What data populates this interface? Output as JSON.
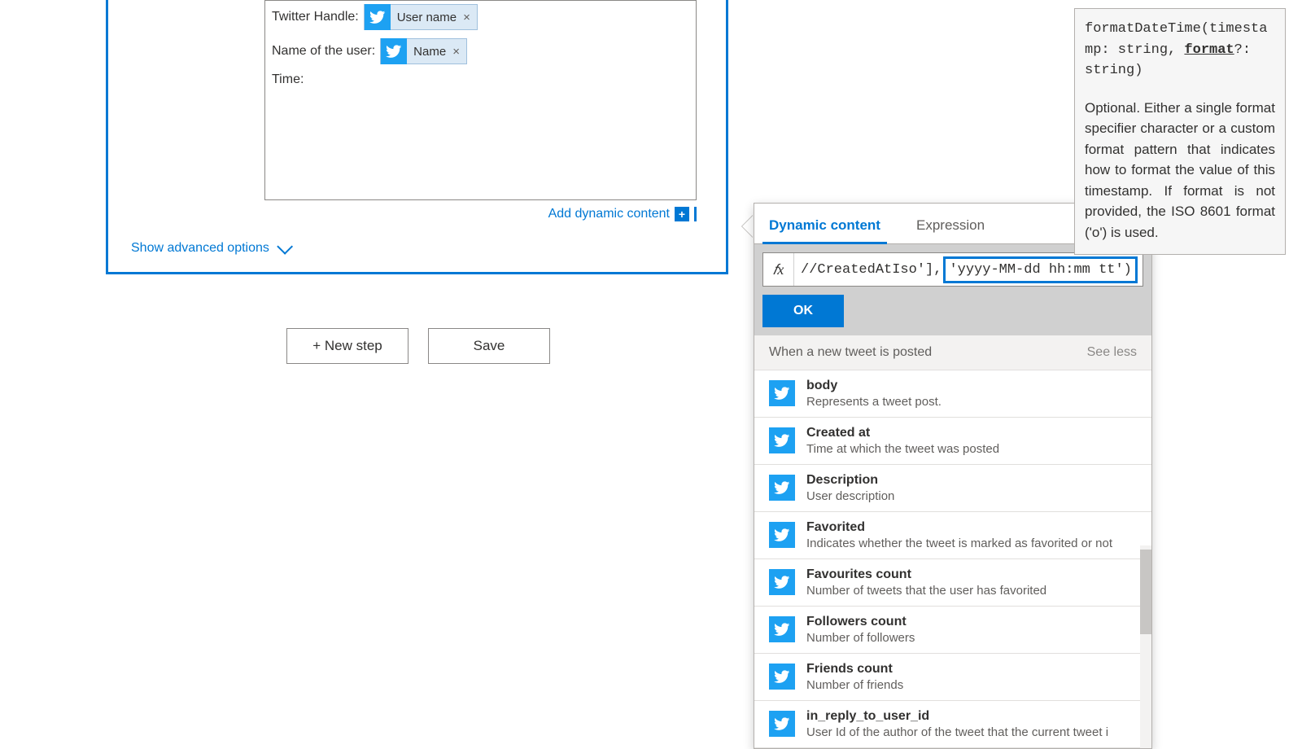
{
  "action": {
    "fields": [
      {
        "label": "Twitter Handle:",
        "token": "User name"
      },
      {
        "label": "Name of the user:",
        "token": "Name"
      },
      {
        "label": "Time:",
        "token": null
      }
    ],
    "add_dynamic_content": "Add dynamic content",
    "advanced_options": "Show advanced options"
  },
  "buttons": {
    "new_step": "+ New step",
    "save": "Save"
  },
  "flyout": {
    "tabs": {
      "dynamic": "Dynamic content",
      "expression": "Expression"
    },
    "fx": "𝑓x",
    "expression_prefix": "//CreatedAtIso'], ",
    "expression_highlight": "'yyyy-MM-dd hh:mm tt')",
    "ok": "OK",
    "section_title": "When a new tweet is posted",
    "see_less": "See less",
    "items": [
      {
        "name": "body",
        "desc": "Represents a tweet post."
      },
      {
        "name": "Created at",
        "desc": "Time at which the tweet was posted"
      },
      {
        "name": "Description",
        "desc": "User description"
      },
      {
        "name": "Favorited",
        "desc": "Indicates whether the tweet is marked as favorited or not"
      },
      {
        "name": "Favourites count",
        "desc": "Number of tweets that the user has favorited"
      },
      {
        "name": "Followers count",
        "desc": "Number of followers"
      },
      {
        "name": "Friends count",
        "desc": "Number of friends"
      },
      {
        "name": "in_reply_to_user_id",
        "desc": "User Id of the author of the tweet that the current tweet i"
      }
    ]
  },
  "tooltip": {
    "sig_pre": "formatDateTime(timestamp: string, ",
    "sig_param": "format",
    "sig_post": "?: string)",
    "body": "Optional. Either a single format specifier character or a custom format pattern that indicates how to format the value of this timestamp. If format is not provided, the ISO 8601 format ('o') is used."
  }
}
